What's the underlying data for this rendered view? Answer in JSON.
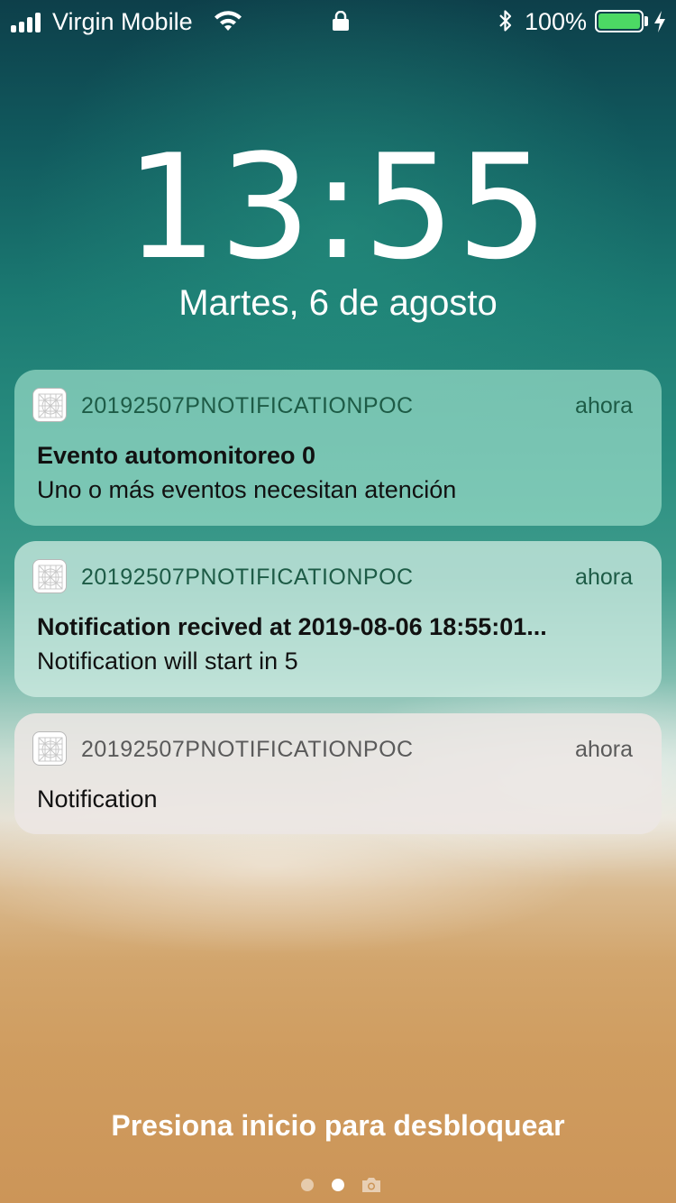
{
  "status_bar": {
    "carrier": "Virgin Mobile",
    "battery_percent": "100%",
    "battery_color": "#4cd964",
    "icons": [
      "signal-icon",
      "wifi-icon",
      "lock-icon",
      "bluetooth-icon",
      "battery-icon",
      "charging-icon"
    ]
  },
  "lock_screen": {
    "time": "13:55",
    "date": "Martes, 6 de agosto"
  },
  "notifications": [
    {
      "app": "20192507PNOTIFICATIONPOC",
      "time": "ahora",
      "title": "Evento automonitoreo 0",
      "body": "Uno o más eventos necesitan atención"
    },
    {
      "app": "20192507PNOTIFICATIONPOC",
      "time": "ahora",
      "title": "Notification recived at 2019-08-06 18:55:01...",
      "body": "Notification will start in 5"
    },
    {
      "app": "20192507PNOTIFICATIONPOC",
      "time": "ahora",
      "body": "Notification"
    }
  ],
  "unlock_hint": "Presiona inicio para desbloquear",
  "page_indicator": {
    "pages": 2,
    "current": 2,
    "extra": "camera-icon"
  }
}
